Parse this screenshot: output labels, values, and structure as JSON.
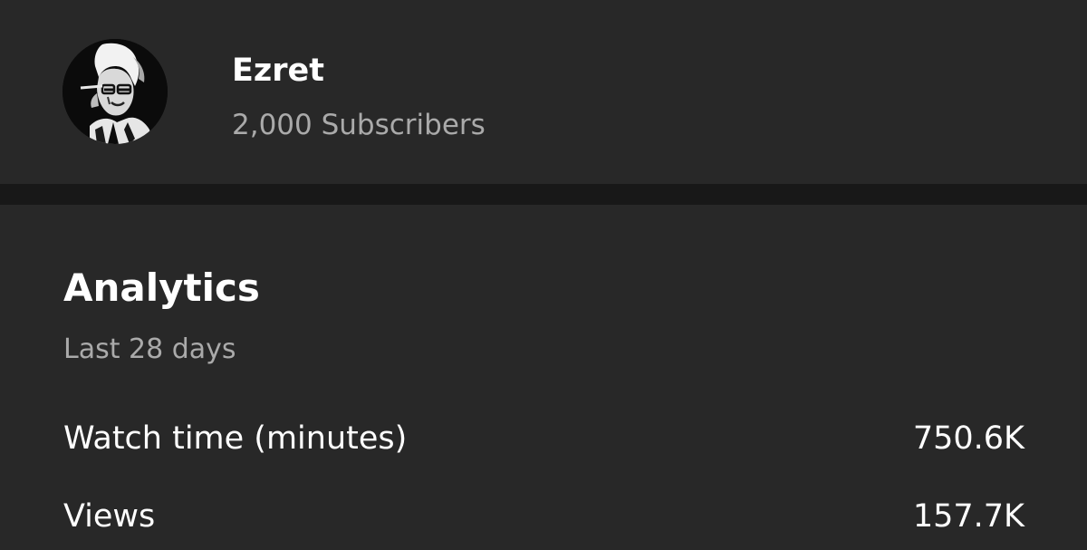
{
  "channel": {
    "name": "Ezret",
    "subscribers": "2,000 Subscribers"
  },
  "analytics": {
    "title": "Analytics",
    "period": "Last 28 days",
    "metrics": [
      {
        "label": "Watch time (minutes)",
        "value": "750.6K"
      },
      {
        "label": "Views",
        "value": "157.7K"
      }
    ]
  },
  "colors": {
    "background": "#282828",
    "divider": "#181818",
    "primary_text": "#ffffff",
    "secondary_text": "#aaaaaa"
  }
}
